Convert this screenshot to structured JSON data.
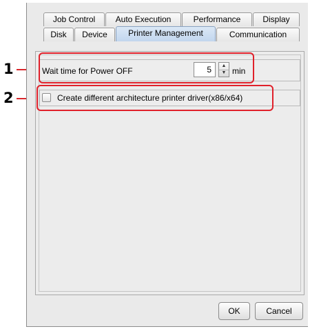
{
  "callouts": [
    {
      "number": "1"
    },
    {
      "number": "2"
    }
  ],
  "tabs_row1": [
    {
      "label": "Job Control"
    },
    {
      "label": "Auto Execution"
    },
    {
      "label": "Performance"
    },
    {
      "label": "Display"
    }
  ],
  "tabs_row2": [
    {
      "label": "Disk"
    },
    {
      "label": "Device"
    },
    {
      "label": "Printer Management",
      "active": true
    },
    {
      "label": "Communication"
    }
  ],
  "wait_time": {
    "label": "Wait time for Power OFF",
    "value": "5",
    "unit": "min"
  },
  "driver_option": {
    "label": "Create different architecture printer driver(x86/x64)",
    "checked": false
  },
  "buttons": {
    "ok": "OK",
    "cancel": "Cancel"
  },
  "colors": {
    "highlight": "#e0202a",
    "active_tab": "#c2d6ee"
  }
}
